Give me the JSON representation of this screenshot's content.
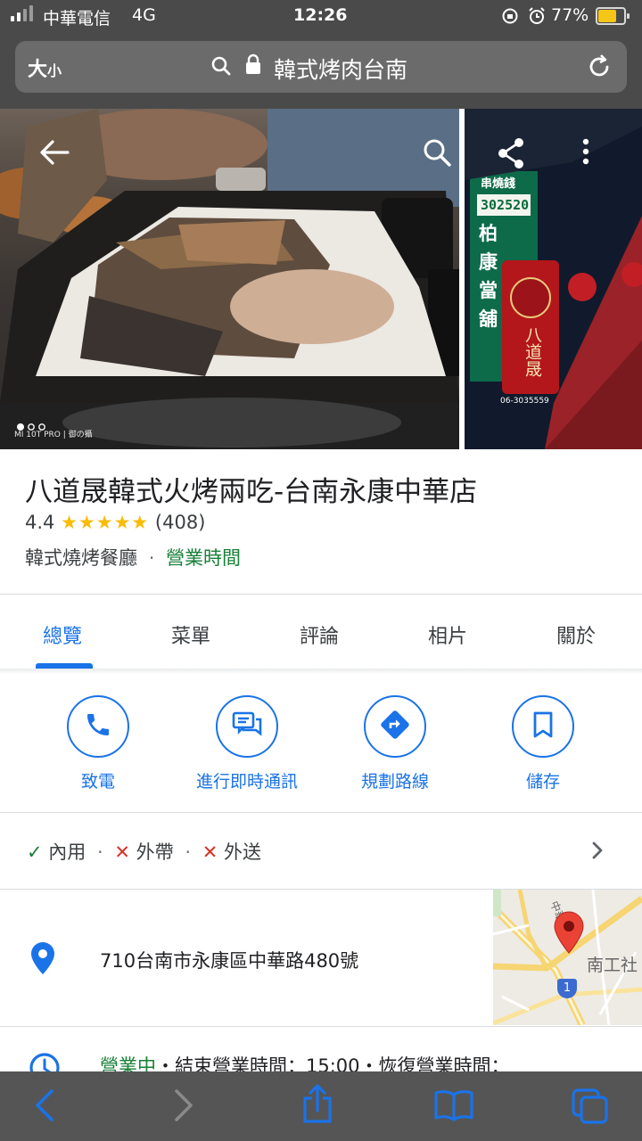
{
  "status_bar": {
    "carrier": "中華電信",
    "network": "4G",
    "time": "12:26",
    "battery_percent": "77%",
    "battery_level": 0.77
  },
  "browser": {
    "text_size_label": "大",
    "text_size_small": "小",
    "query": "韓式烤肉台南"
  },
  "photos": {
    "caption": "MI 10T PRO | 御の攝",
    "sign_number": "302520",
    "sign_vertical": [
      "柏",
      "康",
      "當",
      "舖"
    ],
    "sign_name": "八道晟",
    "sign_phone": "06-3035559",
    "sign_top": "串燒錢"
  },
  "place": {
    "title": "八道晟韓式火烤兩吃-台南永康中華店",
    "rating": "4.4",
    "stars": "★★★★★",
    "review_count": "(408)",
    "category": "韓式燒烤餐廳",
    "separator": "·",
    "hours_link": "營業時間"
  },
  "tabs": [
    "總覽",
    "菜單",
    "評論",
    "相片",
    "關於"
  ],
  "actions": {
    "call": "致電",
    "chat": "進行即時通訊",
    "directions": "規劃路線",
    "save": "儲存"
  },
  "services": {
    "dine_in": "內用",
    "takeout": "外帶",
    "delivery": "外送",
    "sep": "·",
    "check": "✓",
    "cross": "✕"
  },
  "address": "710台南市永康區中華路480號",
  "map": {
    "road_label": "中華一路",
    "poi_label": "南工社",
    "route_shield": "1"
  },
  "hours": {
    "status": "營業中",
    "text": "・結束營業時間：15:00・恢復營業時間："
  },
  "colors": {
    "accent": "#1a73e8",
    "open_green": "#188038",
    "error_red": "#d93025",
    "star": "#fbbc04",
    "chrome_dark": "#4a4a4a"
  }
}
